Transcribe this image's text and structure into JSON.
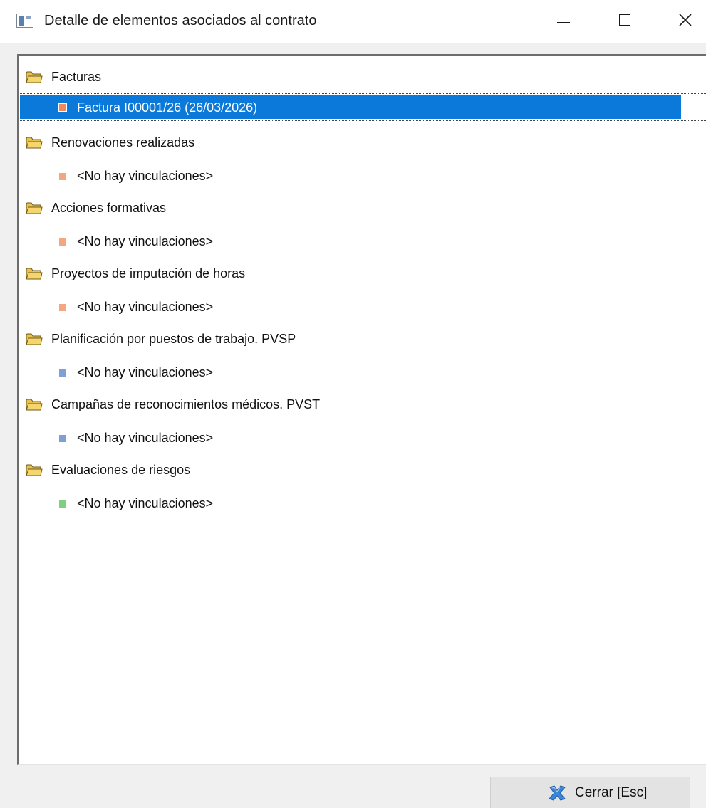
{
  "window": {
    "title": "Detalle de elementos asociados al contrato"
  },
  "tree": {
    "groups": [
      {
        "label": "Facturas",
        "items": [
          {
            "label": "Factura I00001/26  (26/03/2026)",
            "bullet_color": "#f08a5d",
            "selected": true
          }
        ]
      },
      {
        "label": "Renovaciones realizadas",
        "items": [
          {
            "label": "<No hay vinculaciones>",
            "bullet_color": "#f4a582"
          }
        ]
      },
      {
        "label": "Acciones formativas",
        "items": [
          {
            "label": "<No hay vinculaciones>",
            "bullet_color": "#f4a582"
          }
        ]
      },
      {
        "label": "Proyectos de imputación de horas",
        "items": [
          {
            "label": "<No hay vinculaciones>",
            "bullet_color": "#f4a582"
          }
        ]
      },
      {
        "label": "Planificación por puestos de trabajo. PVSP",
        "items": [
          {
            "label": "<No hay vinculaciones>",
            "bullet_color": "#7f9fd6"
          }
        ]
      },
      {
        "label": "Campañas de reconocimientos médicos. PVST",
        "items": [
          {
            "label": "<No hay vinculaciones>",
            "bullet_color": "#7f9fd6"
          }
        ]
      },
      {
        "label": "Evaluaciones de riesgos",
        "items": [
          {
            "label": "<No hay vinculaciones>",
            "bullet_color": "#7fcf7f"
          }
        ]
      }
    ]
  },
  "footer": {
    "close_label": "Cerrar  [Esc]"
  },
  "colors": {
    "selection": "#0a79d9",
    "folder": "#f5d66e",
    "close_x": "#3a86d8"
  }
}
